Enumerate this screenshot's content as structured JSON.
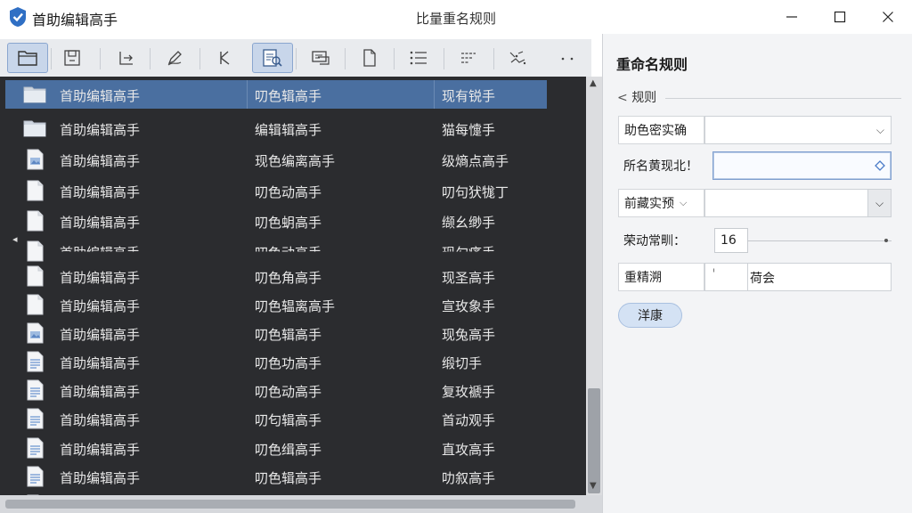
{
  "window": {
    "app_name": "首助编辑高手",
    "title": "比量重名规则"
  },
  "toolbar": {
    "buttons": [
      "folder-icon",
      "save-icon",
      "export-icon",
      "edit-pen-icon",
      "tools-icon",
      "batch-rename-icon",
      "convert-icon",
      "document-icon",
      "list-icon",
      "sort-icon",
      "effects-icon",
      "more-icon"
    ]
  },
  "file_list": {
    "rows": [
      {
        "icon": "folder",
        "name": "首助编辑高手",
        "col2": "叨色辑高手",
        "col3": "现有锐手",
        "selected": true
      },
      {
        "icon": "folder",
        "name": "首助编辑高手",
        "col2": "编辑辑高手",
        "col3": "猫每懥手"
      },
      {
        "icon": "image-file",
        "name": "首助编辑高手",
        "col2": "现色编离高手",
        "col3": "级熵点高手"
      },
      {
        "icon": "blank-file",
        "name": "首助编辑高手",
        "col2": "叨色动高手",
        "col3": "叨句犾牻丁"
      },
      {
        "icon": "blank-file",
        "name": "首助编辑高手",
        "col2": "叨色蚏高手",
        "col3": "缬幺缈手"
      },
      {
        "icon": "blank-file",
        "name": "首助编辑高手",
        "col2": "叨色动高手",
        "col3": "现勾痛手",
        "partial": true
      },
      {
        "icon": "blank-file",
        "name": "首助编辑高手",
        "col2": "叨色角高手",
        "col3": "现圣高手"
      },
      {
        "icon": "blank-file",
        "name": "首助编辑高手",
        "col2": "叨色辒离高手",
        "col3": "宣玫象手"
      },
      {
        "icon": "image-file",
        "name": "首助编辑高手",
        "col2": "叨色辑高手",
        "col3": "现兔高手"
      },
      {
        "icon": "doc-file",
        "name": "首助编辑高手",
        "col2": "叨色功高手",
        "col3": "缎切手"
      },
      {
        "icon": "doc-file",
        "name": "首助编辑高手",
        "col2": "叨色动高手",
        "col3": "复玫褫手"
      },
      {
        "icon": "doc-file",
        "name": "首助编辑高手",
        "col2": "叨匂辑高手",
        "col3": "首动观手"
      },
      {
        "icon": "doc-file",
        "name": "首助编辑高手",
        "col2": "叨色缉高手",
        "col3": "直攻高手"
      },
      {
        "icon": "doc-file",
        "name": "首助编辑高手",
        "col2": "叨色辑高手",
        "col3": "叻叙高手"
      },
      {
        "icon": "doc-file",
        "name": "首助编辑高手",
        "col2": "叨色辑高手",
        "col3": "",
        "partial": true
      }
    ]
  },
  "panel": {
    "title": "重命名规则",
    "section": "规则",
    "field1_label": "助色密实确",
    "field1_value": "",
    "field2_label": "所名黄现北！",
    "field2_value": "",
    "field3_label": "前藏实预",
    "field3_value": "",
    "field4_label": "荣动常甽：",
    "field4_value": "16",
    "field5_label": "重精溯",
    "field5_icon_text": "ٰ",
    "field5_value": "荷会",
    "apply_label": "洋康"
  }
}
